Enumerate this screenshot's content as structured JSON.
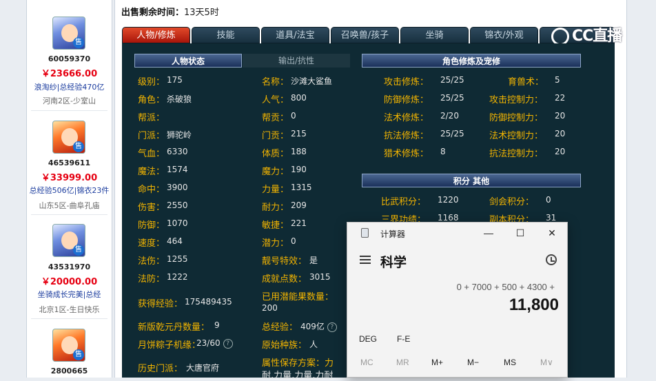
{
  "sellers": [
    {
      "id": "60059370",
      "price": "￥23666.00",
      "desc": "浪淘纱|总经验470亿",
      "server": "河南2区-少室山",
      "avatar": "blue",
      "badge": "售"
    },
    {
      "id": "46539611",
      "price": "￥33999.00",
      "desc": "总经验506亿|锦衣23件",
      "server": "山东5区-曲阜孔庙",
      "avatar": "red",
      "badge": "售"
    },
    {
      "id": "43531970",
      "price": "￥20000.00",
      "desc": "坐骑成长完美|总经",
      "server": "北京1区-生日快乐",
      "avatar": "blue",
      "badge": "售"
    },
    {
      "id": "2800665",
      "price": "",
      "desc": "",
      "server": "",
      "avatar": "red",
      "badge": "售"
    }
  ],
  "remain": {
    "label": "出售剩余时间：",
    "value": "13天5时"
  },
  "tabs": [
    "人物/修炼",
    "技能",
    "道具/法宝",
    "召唤兽/孩子",
    "坐骑",
    "锦衣/外观"
  ],
  "logo_text": "CC直播",
  "status": {
    "header_active": "人物状态",
    "header_inactive": "输出/抗性",
    "left": [
      {
        "label": "级别：",
        "value": "175"
      },
      {
        "label": "角色：",
        "value": "杀破狼"
      },
      {
        "label": "帮派：",
        "value": ""
      },
      {
        "label": "门派：",
        "value": "狮驼岭"
      },
      {
        "label": "气血：",
        "value": "6330"
      },
      {
        "label": "魔法：",
        "value": "1574"
      },
      {
        "label": "命中：",
        "value": "3900"
      },
      {
        "label": "伤害：",
        "value": "2550"
      },
      {
        "label": "防御：",
        "value": "1070"
      },
      {
        "label": "速度：",
        "value": "464"
      },
      {
        "label": "法伤：",
        "value": "1255"
      },
      {
        "label": "法防：",
        "value": "1222"
      }
    ],
    "right": [
      {
        "label": "名称：",
        "value": "沙滩大鲨鱼"
      },
      {
        "label": "人气：",
        "value": "800"
      },
      {
        "label": "帮贡：",
        "value": "0"
      },
      {
        "label": "门贡：",
        "value": "215"
      },
      {
        "label": "体质：",
        "value": "188"
      },
      {
        "label": "魔力：",
        "value": "190"
      },
      {
        "label": "力量：",
        "value": "1315"
      },
      {
        "label": "耐力：",
        "value": "209"
      },
      {
        "label": "敏捷：",
        "value": "221"
      },
      {
        "label": "潜力：",
        "value": "0"
      },
      {
        "label": "靓号特效：",
        "value": "是"
      },
      {
        "label": "成就点数：",
        "value": "3015"
      }
    ],
    "exp_label": "获得经验：",
    "exp_value": "175489435",
    "potential_label": "已用潜能果数量：",
    "potential_value": "200",
    "pill_label": "新版乾元丹数量：",
    "pill_value": "9",
    "total_exp_label": "总经验：",
    "total_exp_value": "409亿",
    "zongzi_label": "月饼粽子机缘：",
    "zongzi_value": "23/60",
    "race_label": "原始种族：",
    "race_value": "人",
    "hist_school_label": "历史门派：",
    "hist_school_value": "大唐官府",
    "attr_plan_label": "属性保存方案：力",
    "attr_plan_value": "耐,力量,力量,力耐"
  },
  "cultivation": {
    "header": "角色修炼及宠修",
    "rows": [
      {
        "l1": "攻击修炼：",
        "v1": "25/25",
        "l2": "育兽术：",
        "v2": "5"
      },
      {
        "l1": "防御修炼：",
        "v1": "25/25",
        "l2": "攻击控制力：",
        "v2": "22"
      },
      {
        "l1": "法术修炼：",
        "v1": "2/20",
        "l2": "防御控制力：",
        "v2": "20"
      },
      {
        "l1": "抗法修炼：",
        "v1": "25/25",
        "l2": "法术控制力：",
        "v2": "20"
      },
      {
        "l1": "猎术修炼：",
        "v1": "8",
        "l2": "抗法控制力：",
        "v2": "20"
      }
    ]
  },
  "points": {
    "header": "积分  其他",
    "rows": [
      {
        "l1": "比武积分：",
        "v1": "1220",
        "l2": "剑会积分：",
        "v2": "0"
      },
      {
        "l1": "三界功绩：",
        "v1": "1168",
        "l2": "副本积分：",
        "v2": "31"
      }
    ]
  },
  "calculator": {
    "title": "计算器",
    "mode": "科学",
    "expression": "0 + 7000 + 500 + 4300 +",
    "result": "11,800",
    "angle_unit": "DEG",
    "fe_label": "F-E",
    "memory": [
      "MC",
      "MR",
      "M+",
      "M−",
      "MS",
      "M∨"
    ]
  }
}
